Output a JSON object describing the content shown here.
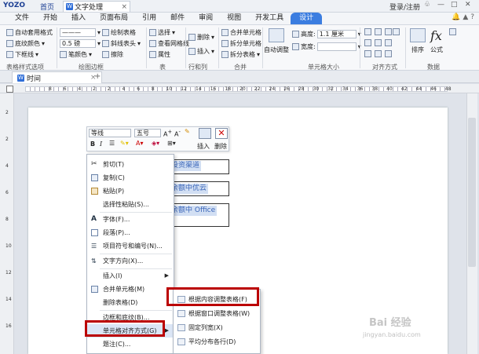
{
  "titlebar": {
    "logo": "YOZO",
    "home": "首页",
    "doc_title": "文字处理",
    "login": "登录/注册"
  },
  "menubar": {
    "tabs": [
      "文件",
      "开始",
      "插入",
      "页面布局",
      "引用",
      "邮件",
      "审阅",
      "视图",
      "开发工具",
      "设计"
    ],
    "active": "设计"
  },
  "toolbar": {
    "auto_table_style": "自动套用格式",
    "shading_color": "底纹颜色",
    "underline": "下框线",
    "line_width": "0.5 磅",
    "pen_color": "笔颜色",
    "draw_table": "绘制表格",
    "diag_header": "斜线表头",
    "erase": "擦除",
    "select": "选择",
    "view_grid": "查看网格线",
    "properties": "属性",
    "delete": "删除",
    "insert": "插入",
    "merge_cells": "合并单元格",
    "split_cells": "拆分单元格",
    "split_table": "拆分表格",
    "auto_fit": "自动调整",
    "height_label": "高度:",
    "height_value": "1.1 厘米",
    "width_label": "宽度:",
    "sort": "排序",
    "formula": "公式",
    "groups": [
      "表格样式选项",
      "绘图边框",
      "表",
      "行和列",
      "合并",
      "单元格大小",
      "对齐方式",
      "数据"
    ]
  },
  "doctab": {
    "label": "时间",
    "plus": "+"
  },
  "ruler": {
    "numbers": [
      "8",
      "6",
      "4",
      "2",
      "2",
      "4",
      "6",
      "8",
      "10",
      "12",
      "14",
      "16",
      "18",
      "20",
      "22",
      "24",
      "26",
      "28",
      "30",
      "32",
      "34",
      "36",
      "38",
      "40",
      "42",
      "44",
      "46",
      "48"
    ],
    "vnumbers": [
      "2",
      "2",
      "4",
      "6",
      "8",
      "10",
      "12",
      "14",
      "16"
    ]
  },
  "document": {
    "cells": [
      "投资渠道",
      "余额中优云",
      "余额中 Office"
    ]
  },
  "minitoolbar": {
    "font": "等线",
    "size": "五号",
    "bold": "B",
    "italic": "I",
    "insert": "插入",
    "delete": "删除"
  },
  "context_menu": {
    "items": [
      {
        "label": "剪切(T)",
        "icon": "scissors-icon"
      },
      {
        "label": "复制(C)",
        "icon": "copy-icon"
      },
      {
        "label": "粘贴(P)",
        "icon": "paste-icon"
      },
      {
        "label": "选择性粘贴(S)...",
        "icon": ""
      },
      {
        "label": "字体(F)...",
        "icon": "font-icon"
      },
      {
        "label": "段落(P)...",
        "icon": "paragraph-icon"
      },
      {
        "label": "项目符号和编号(N)...",
        "icon": "bullets-icon"
      },
      {
        "label": "文字方向(X)...",
        "icon": "text-direction-icon"
      },
      {
        "label": "插入(I)",
        "icon": "",
        "submenu": true
      },
      {
        "label": "合并单元格(M)",
        "icon": "merge-icon"
      },
      {
        "label": "删除表格(D)",
        "icon": ""
      },
      {
        "label": "边框和底纹(B)...",
        "icon": ""
      },
      {
        "label": "单元格对齐方式(G)",
        "icon": "",
        "submenu": true
      },
      {
        "label": "题注(C)...",
        "icon": ""
      }
    ]
  },
  "submenu": {
    "items": [
      "根据内容调整表格(F)",
      "根据窗口调整表格(W)",
      "固定列宽(X)",
      "平均分布各行(D)"
    ]
  },
  "watermark": {
    "brand": "Bai 经验",
    "url": "jingyan.baidu.com"
  }
}
